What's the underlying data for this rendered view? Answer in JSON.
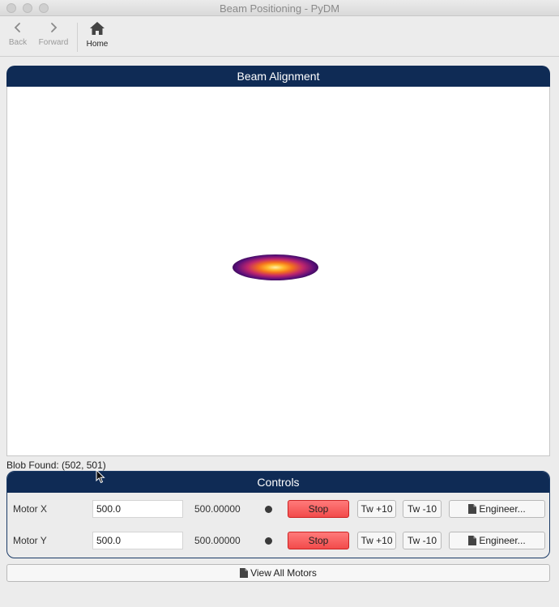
{
  "window": {
    "title": "Beam Positioning - PyDM"
  },
  "toolbar": {
    "back_label": "Back",
    "forward_label": "Forward",
    "home_label": "Home"
  },
  "beam": {
    "header": "Beam Alignment",
    "status": "Blob Found: (502, 501)"
  },
  "controls": {
    "header": "Controls",
    "motors": [
      {
        "name": "Motor X",
        "setpoint": "500.0",
        "readback": "500.00000",
        "stop_label": "Stop",
        "tw_plus": "Tw +10",
        "tw_minus": "Tw -10",
        "engineer_label": "Engineer..."
      },
      {
        "name": "Motor Y",
        "setpoint": "500.0",
        "readback": "500.00000",
        "stop_label": "Stop",
        "tw_plus": "Tw +10",
        "tw_minus": "Tw -10",
        "engineer_label": "Engineer..."
      }
    ]
  },
  "footer": {
    "view_all_label": "View All Motors"
  },
  "icons": {
    "back": "chevron-left-icon",
    "forward": "chevron-right-icon",
    "home": "home-icon",
    "document": "document-icon"
  },
  "colors": {
    "header_bg": "#0f2b55",
    "stop_bg": "#f24b4b"
  }
}
